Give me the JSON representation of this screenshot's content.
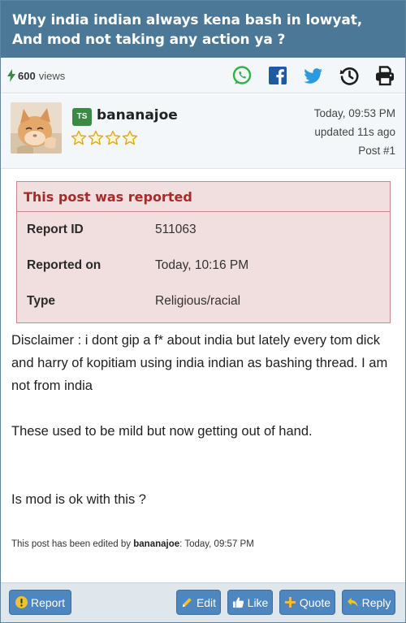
{
  "thread": {
    "title": "Why india indian always kena bash in lowyat, And mod not taking any action ya ?"
  },
  "stats": {
    "views_count": "600",
    "views_label": "views",
    "share_icons": [
      "whatsapp-icon",
      "facebook-icon",
      "twitter-icon",
      "history-icon",
      "print-icon"
    ]
  },
  "post": {
    "badge": "TS",
    "username": "bananajoe",
    "stars": 4,
    "posted": "Today, 09:53 PM",
    "updated": "updated 11s ago",
    "post_number": "Post #1"
  },
  "report": {
    "title": "This post was reported",
    "rows": [
      {
        "key": "Report ID",
        "value": "511063"
      },
      {
        "key": "Reported on",
        "value": "Today, 10:16 PM"
      },
      {
        "key": "Type",
        "value": "Religious/racial"
      }
    ]
  },
  "body": {
    "paragraphs": [
      "Disclaimer : i dont gip a f* about india but lately every tom dick and harry of kopitiam using india indian as bashing thread. I am not from india",
      "These used to be mild but now getting out of hand.",
      "Is mod is ok with this ?"
    ]
  },
  "edit_note": {
    "prefix": "This post has been edited by",
    "editor": "bananajoe",
    "suffix": ": Today, 09:57 PM"
  },
  "actions": {
    "report": "Report",
    "edit": "Edit",
    "like": "Like",
    "quote": "Quote",
    "reply": "Reply"
  },
  "colors": {
    "header": "#4a7896",
    "report_bg": "#f1dede",
    "report_title": "#a62b2b",
    "button": "#4e86bf",
    "ts_badge": "#3a8a45"
  }
}
